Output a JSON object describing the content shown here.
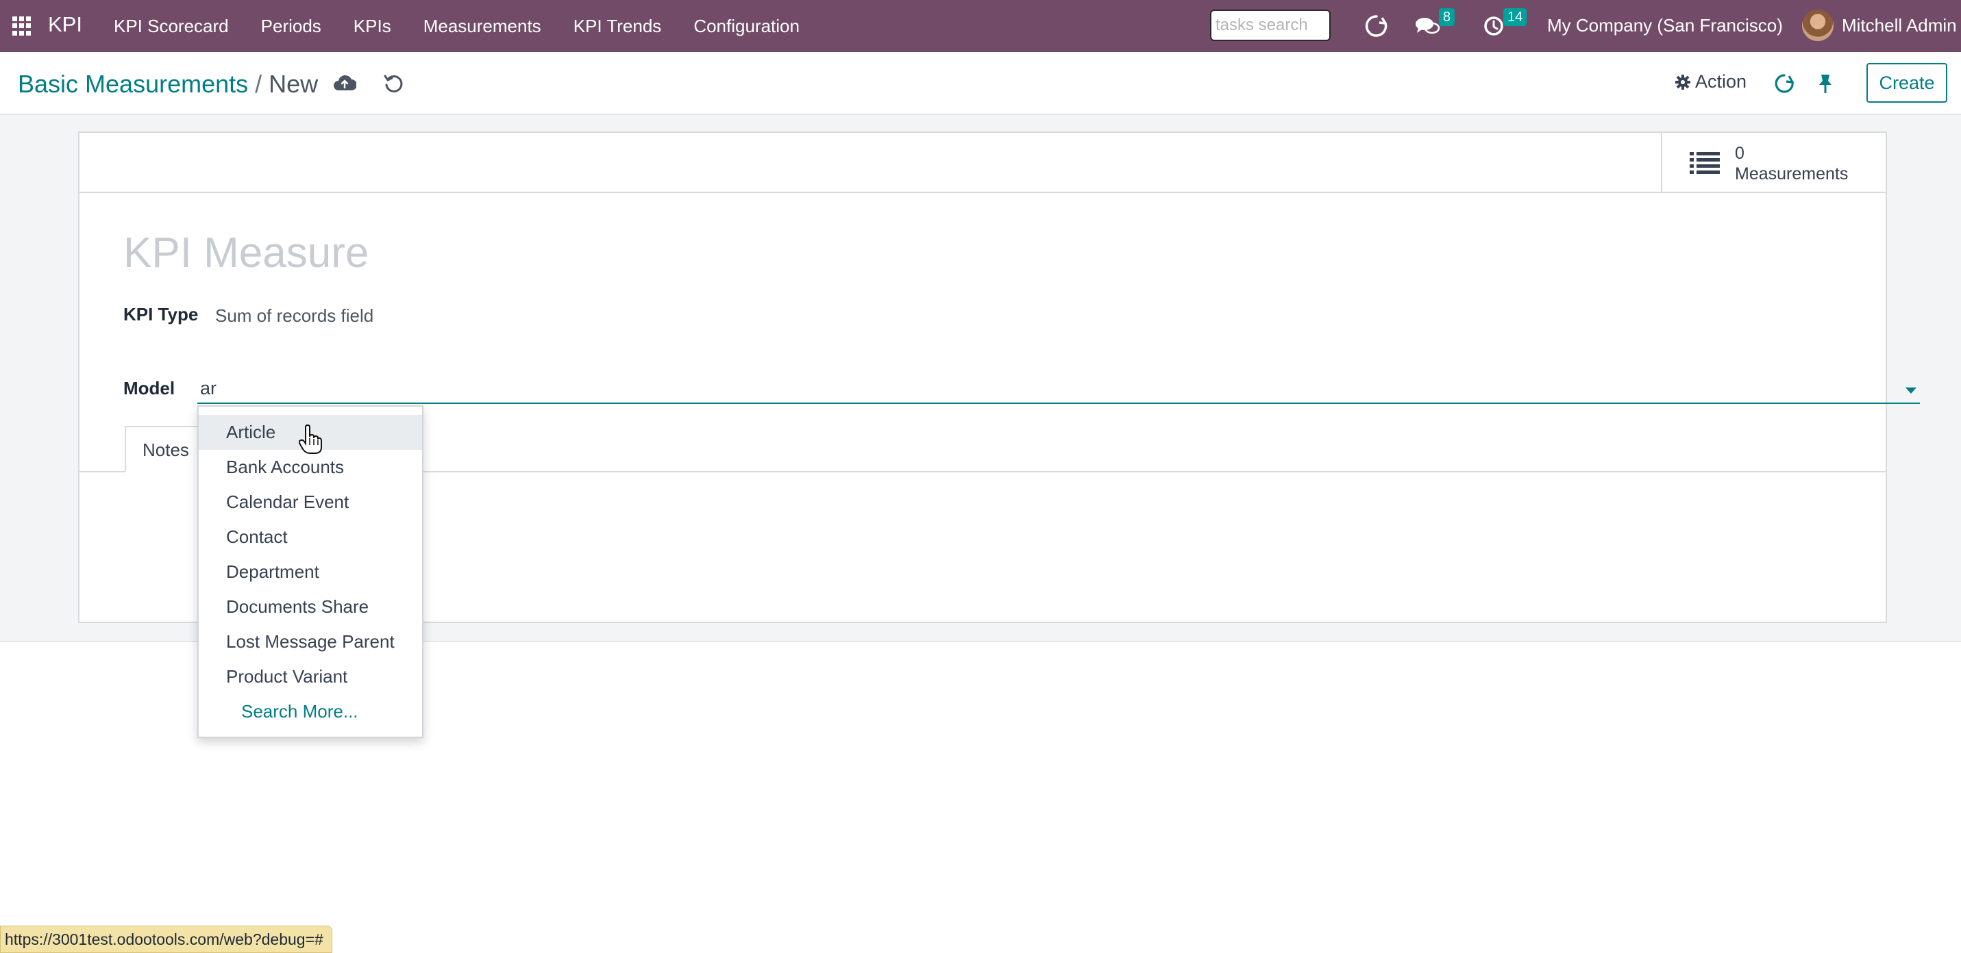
{
  "navbar": {
    "brand": "KPI",
    "menu": [
      "KPI Scorecard",
      "Periods",
      "KPIs",
      "Measurements",
      "KPI Trends",
      "Configuration"
    ],
    "search_placeholder": "tasks search",
    "messages_count": "8",
    "activities_count": "14",
    "company": "My Company (San Francisco)",
    "user": "Mitchell Admin",
    "icons": [
      "apps-grid-icon",
      "odoobot-icon",
      "chat-icon",
      "clock-icon"
    ],
    "color": "#714b67"
  },
  "control": {
    "breadcrumb_parent": "Basic Measurements",
    "breadcrumb_separator": "/",
    "breadcrumb_current": "New",
    "action_label": "Action",
    "create_label": "Create",
    "accent_color": "#017e84"
  },
  "form": {
    "stat_value": "0",
    "stat_label": "Measurements",
    "title_placeholder": "KPI Measure",
    "kpi_type_label": "KPI Type",
    "kpi_type_value": "Sum of records field",
    "model_label": "Model",
    "model_value": "ar",
    "tab_notes": "Notes"
  },
  "dropdown": {
    "items": [
      "Article",
      "Bank Accounts",
      "Calendar Event",
      "Contact",
      "Department",
      "Documents Share",
      "Lost Message Parent",
      "Product Variant"
    ],
    "search_more": "Search More...",
    "highlighted": "Article"
  },
  "statusbar": {
    "url": "https://3001test.odootools.com/web?debug=#"
  }
}
